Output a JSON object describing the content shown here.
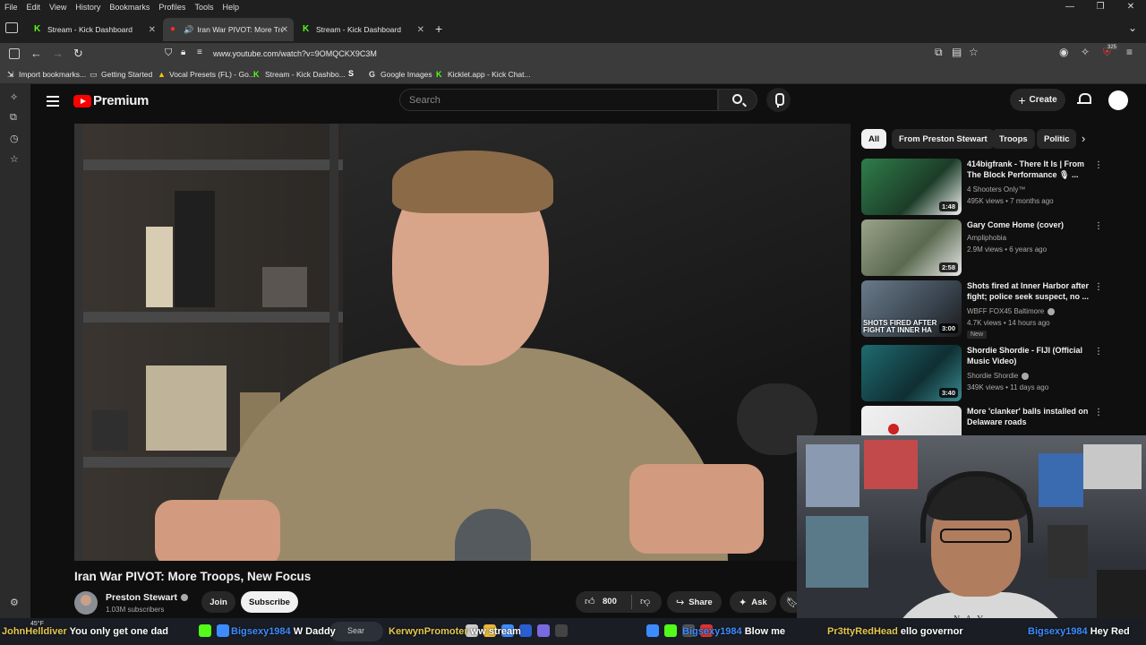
{
  "menu": [
    "File",
    "Edit",
    "View",
    "History",
    "Bookmarks",
    "Profiles",
    "Tools",
    "Help"
  ],
  "window_controls": [
    "—",
    "❐",
    "✕"
  ],
  "tabs": [
    {
      "label": "Stream - Kick Dashboard",
      "icon": "kick-icon"
    },
    {
      "label": "Iran War PIVOT: More Troop",
      "icon": "youtube-icon",
      "audio": true
    },
    {
      "label": "Stream - Kick Dashboard",
      "icon": "kick-icon"
    }
  ],
  "url": "www.youtube.com/watch?v=9OMQCKX9C3M",
  "bookmarks": [
    {
      "label": "Import bookmarks...",
      "icon": "import-icon"
    },
    {
      "label": "Getting Started",
      "icon": "folder-icon"
    },
    {
      "label": "Vocal Presets (FL) - Go...",
      "icon": "drive-icon"
    },
    {
      "label": "Stream - Kick Dashbo...",
      "icon": "kick-icon"
    },
    {
      "label": "",
      "icon": "s-icon"
    },
    {
      "label": "Google Images",
      "icon": "google-icon"
    },
    {
      "label": "Kicklet.app - Kick Chat...",
      "icon": "kicklet-icon"
    }
  ],
  "extension_badge": "325",
  "youtube": {
    "logo_text": "Premium",
    "search_placeholder": "Search",
    "create_label": "Create",
    "video": {
      "title": "Iran War PIVOT: More Troops, New Focus",
      "channel": "Preston Stewart",
      "subscribers": "1.03M subscribers",
      "join_label": "Join",
      "subscribe_label": "Subscribe",
      "likes": "800",
      "share_label": "Share",
      "ask_label": "Ask"
    },
    "chips": [
      "All",
      "From Preston Stewart",
      "Troops",
      "Politic"
    ],
    "recommendations": [
      {
        "title": "414bigfrank - There It Is | From The Block Performance 🎙 ...",
        "channel": "4 Shooters Only™",
        "meta": "495K views • 7 months ago",
        "duration": "1:48",
        "thumb_color": "#2f7d4a"
      },
      {
        "title": "Gary Come Home (cover)",
        "channel": "Ampliphobia",
        "meta": "2.9M views • 6 years ago",
        "duration": "2:58",
        "thumb_color": "#7d8a70"
      },
      {
        "title": "Shots fired at Inner Harbor after fight; police seek suspect, no ...",
        "channel": "WBFF FOX45 Baltimore",
        "meta": "4.7K views • 14 hours ago",
        "duration": "3:00",
        "badge": "New",
        "overlay": "SHOTS FIRED AFTER FIGHT AT INNER HA",
        "thumb_color": "#4a5a6a"
      },
      {
        "title": "Shordie Shordie - FIJI (Official Music Video)",
        "channel": "Shordie Shordie",
        "meta": "349K views • 11 days ago",
        "duration": "3:40",
        "thumb_color": "#1f6b70"
      },
      {
        "title": "More 'clanker' balls installed on Delaware roads",
        "channel": "",
        "meta": "",
        "duration": "",
        "thumb_color": "#e8e8e8"
      }
    ]
  },
  "webcam": {
    "shirt_text": "N A Y"
  },
  "taskbar": {
    "weather": "45°F",
    "search_label": "Sear",
    "chat": [
      {
        "user": "JohnHelldiver",
        "message": "You only get one dad"
      },
      {
        "user": "Bigsexy1984",
        "message": "W Daddy"
      },
      {
        "user": "KerwynPromoter",
        "message": "ww stream"
      },
      {
        "user": "Bigsexy1984",
        "message": "Blow me"
      },
      {
        "user": "Pr3ttyRedHead",
        "message": "ello governor"
      },
      {
        "user": "Bigsexy1984",
        "message": "Hey Red"
      }
    ]
  }
}
